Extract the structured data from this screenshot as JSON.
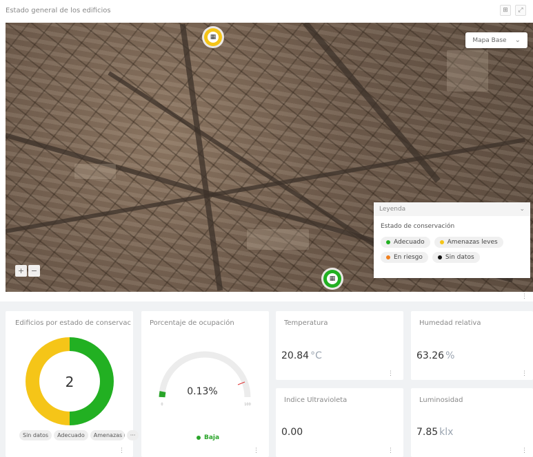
{
  "header": {
    "title": "Estado general de los edificios"
  },
  "map": {
    "basemap_label": "Mapa Base",
    "legend": {
      "title": "Leyenda",
      "subtitle": "Estado de conservación",
      "items": [
        {
          "label": "Adecuado",
          "color": "#22b022"
        },
        {
          "label": "Amenazas leves",
          "color": "#f5c518"
        },
        {
          "label": "En riesgo",
          "color": "#f08020"
        },
        {
          "label": "Sin datos",
          "color": "#111111"
        }
      ]
    },
    "markers": [
      {
        "status": "Amenazas leves",
        "color": "#f5c518",
        "icon": "building-icon"
      },
      {
        "status": "Adecuado",
        "color": "#22b022",
        "icon": "building-icon"
      }
    ],
    "zoom": {
      "in": "+",
      "out": "−"
    }
  },
  "cards": {
    "donut": {
      "title": "Edificios por estado de conservación",
      "total": "2",
      "chips": [
        "Sin datos",
        "Adecuado",
        "Amenazas leves",
        "···"
      ]
    },
    "occupancy": {
      "title": "Porcentaje de ocupación",
      "value": "0.13%",
      "min": "0",
      "max": "100",
      "status": "Baja",
      "status_color": "#2aa52a"
    },
    "temperature": {
      "title": "Temperatura",
      "value": "20.84",
      "unit": "°C"
    },
    "humidity": {
      "title": "Humedad relativa",
      "value": "63.26",
      "unit": "%"
    },
    "uv": {
      "title": "Índice Ultravioleta",
      "value": "0.00"
    },
    "light": {
      "title": "Luminosidad",
      "value": "7.85",
      "unit": "klx"
    }
  },
  "chart_data": {
    "type": "pie",
    "categories": [
      "Adecuado",
      "Amenazas leves"
    ],
    "values": [
      1,
      1
    ],
    "colors": [
      "#22b022",
      "#f5c518"
    ]
  }
}
